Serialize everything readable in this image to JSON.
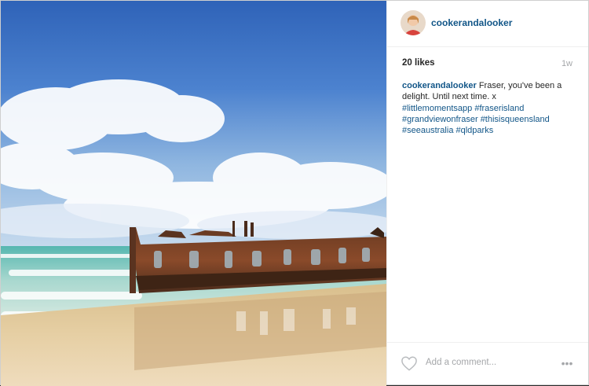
{
  "post": {
    "username": "cookerandalooker",
    "likes": "20 likes",
    "time": "1w",
    "caption_text": "Fraser, you've been a delight. Until next time. x",
    "hashtags": [
      "#littlemomentsapp",
      "#fraserisland",
      "#grandviewonfraser",
      "#thisisqueensland",
      "#seeaustralia",
      "#qldparks"
    ],
    "comment_placeholder": "Add a comment...",
    "more_glyph": "•••"
  },
  "icons": {
    "like": "heart-icon",
    "more": "more-options-icon"
  },
  "colors": {
    "link": "#125688",
    "muted": "#a5a7aa"
  }
}
